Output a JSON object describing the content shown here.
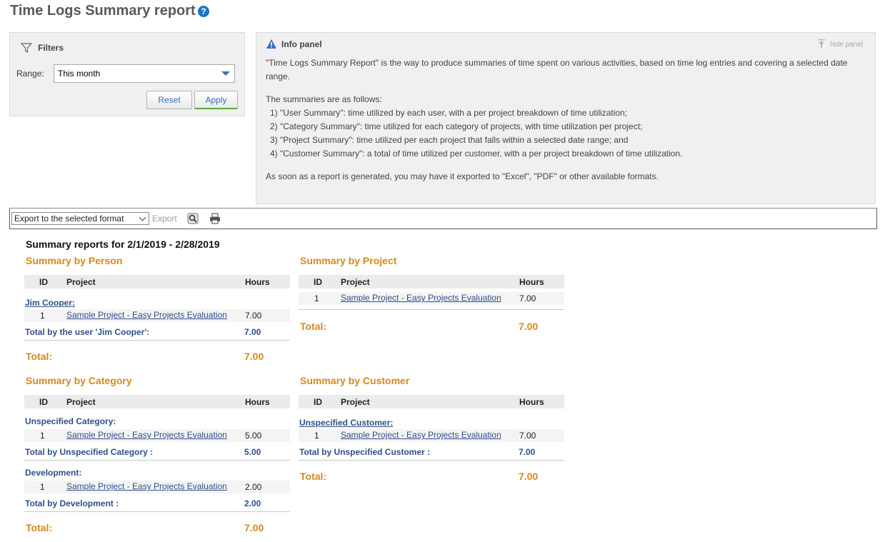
{
  "page": {
    "title": "Time Logs Summary report",
    "help_icon": "?"
  },
  "filters": {
    "label": "Filters",
    "range_label": "Range:",
    "range_value": "This month",
    "reset_label": "Reset",
    "apply_label": "Apply"
  },
  "info": {
    "title": "Info panel",
    "hide_label": "hide panel",
    "p1a": "\"Time Logs Summary Report\" is the way to produce summaries of time spent on various activities, based on time log entries and covering a selected date",
    "p1b": "range.",
    "p2": "The summaries are as follows:",
    "item1": "1) \"User Summary\": time utilized by each user, with a per project breakdown of time utilization;",
    "item2": "2) \"Category Summary\": time utilized for each category of projects, with time utilization per project;",
    "item3": "3) \"Project Summary\": time utilized per each project that falls within a selected date range; and",
    "item4": "4) \"Customer Summary\": a total of time utilized per customer, with a per project breakdown of time utilization.",
    "p3": "As soon as a report is generated, you may have it exported to \"Excel\", \"PDF\" or other available formats."
  },
  "export": {
    "select_value": "Export to the selected format",
    "export_label": "Export"
  },
  "report": {
    "heading": "Summary reports  for 2/1/2019 - 2/28/2019",
    "columns": {
      "id": "ID",
      "project": "Project",
      "hours": "Hours"
    },
    "project_name": "Sample Project - Easy Projects Evaluation",
    "person": {
      "title": "Summary by Person",
      "group_name": "Jim Cooper:",
      "row_id": "1",
      "row_hours": "7.00",
      "subtotal_label": "Total by the user 'Jim Cooper':",
      "subtotal_value": "7.00",
      "total_label": "Total:",
      "total_value": "7.00"
    },
    "project": {
      "title": "Summary by Project",
      "row_id": "1",
      "row_hours": "7.00",
      "total_label": "Total:",
      "total_value": "7.00"
    },
    "category": {
      "title": "Summary by Category",
      "group1_name": "Unspecified Category:",
      "group1_row_id": "1",
      "group1_row_hours": "5.00",
      "group1_subtotal_label": "Total by Unspecified Category :",
      "group1_subtotal_value": "5.00",
      "group2_name": "Development:",
      "group2_row_id": "1",
      "group2_row_hours": "2.00",
      "group2_subtotal_label": "Total by Development :",
      "group2_subtotal_value": "2.00",
      "total_label": "Total:",
      "total_value": "7.00"
    },
    "customer": {
      "title": "Summary by Customer",
      "group_name": "Unspecified Customer:",
      "row_id": "1",
      "row_hours": "7.00",
      "subtotal_label": "Total by Unspecified Customer :",
      "subtotal_value": "7.00",
      "total_label": "Total:",
      "total_value": "7.00"
    }
  },
  "colors": {
    "accent_orange": "#d38a1b",
    "link_blue": "#2f4f88",
    "help_blue": "#1a76c6"
  }
}
